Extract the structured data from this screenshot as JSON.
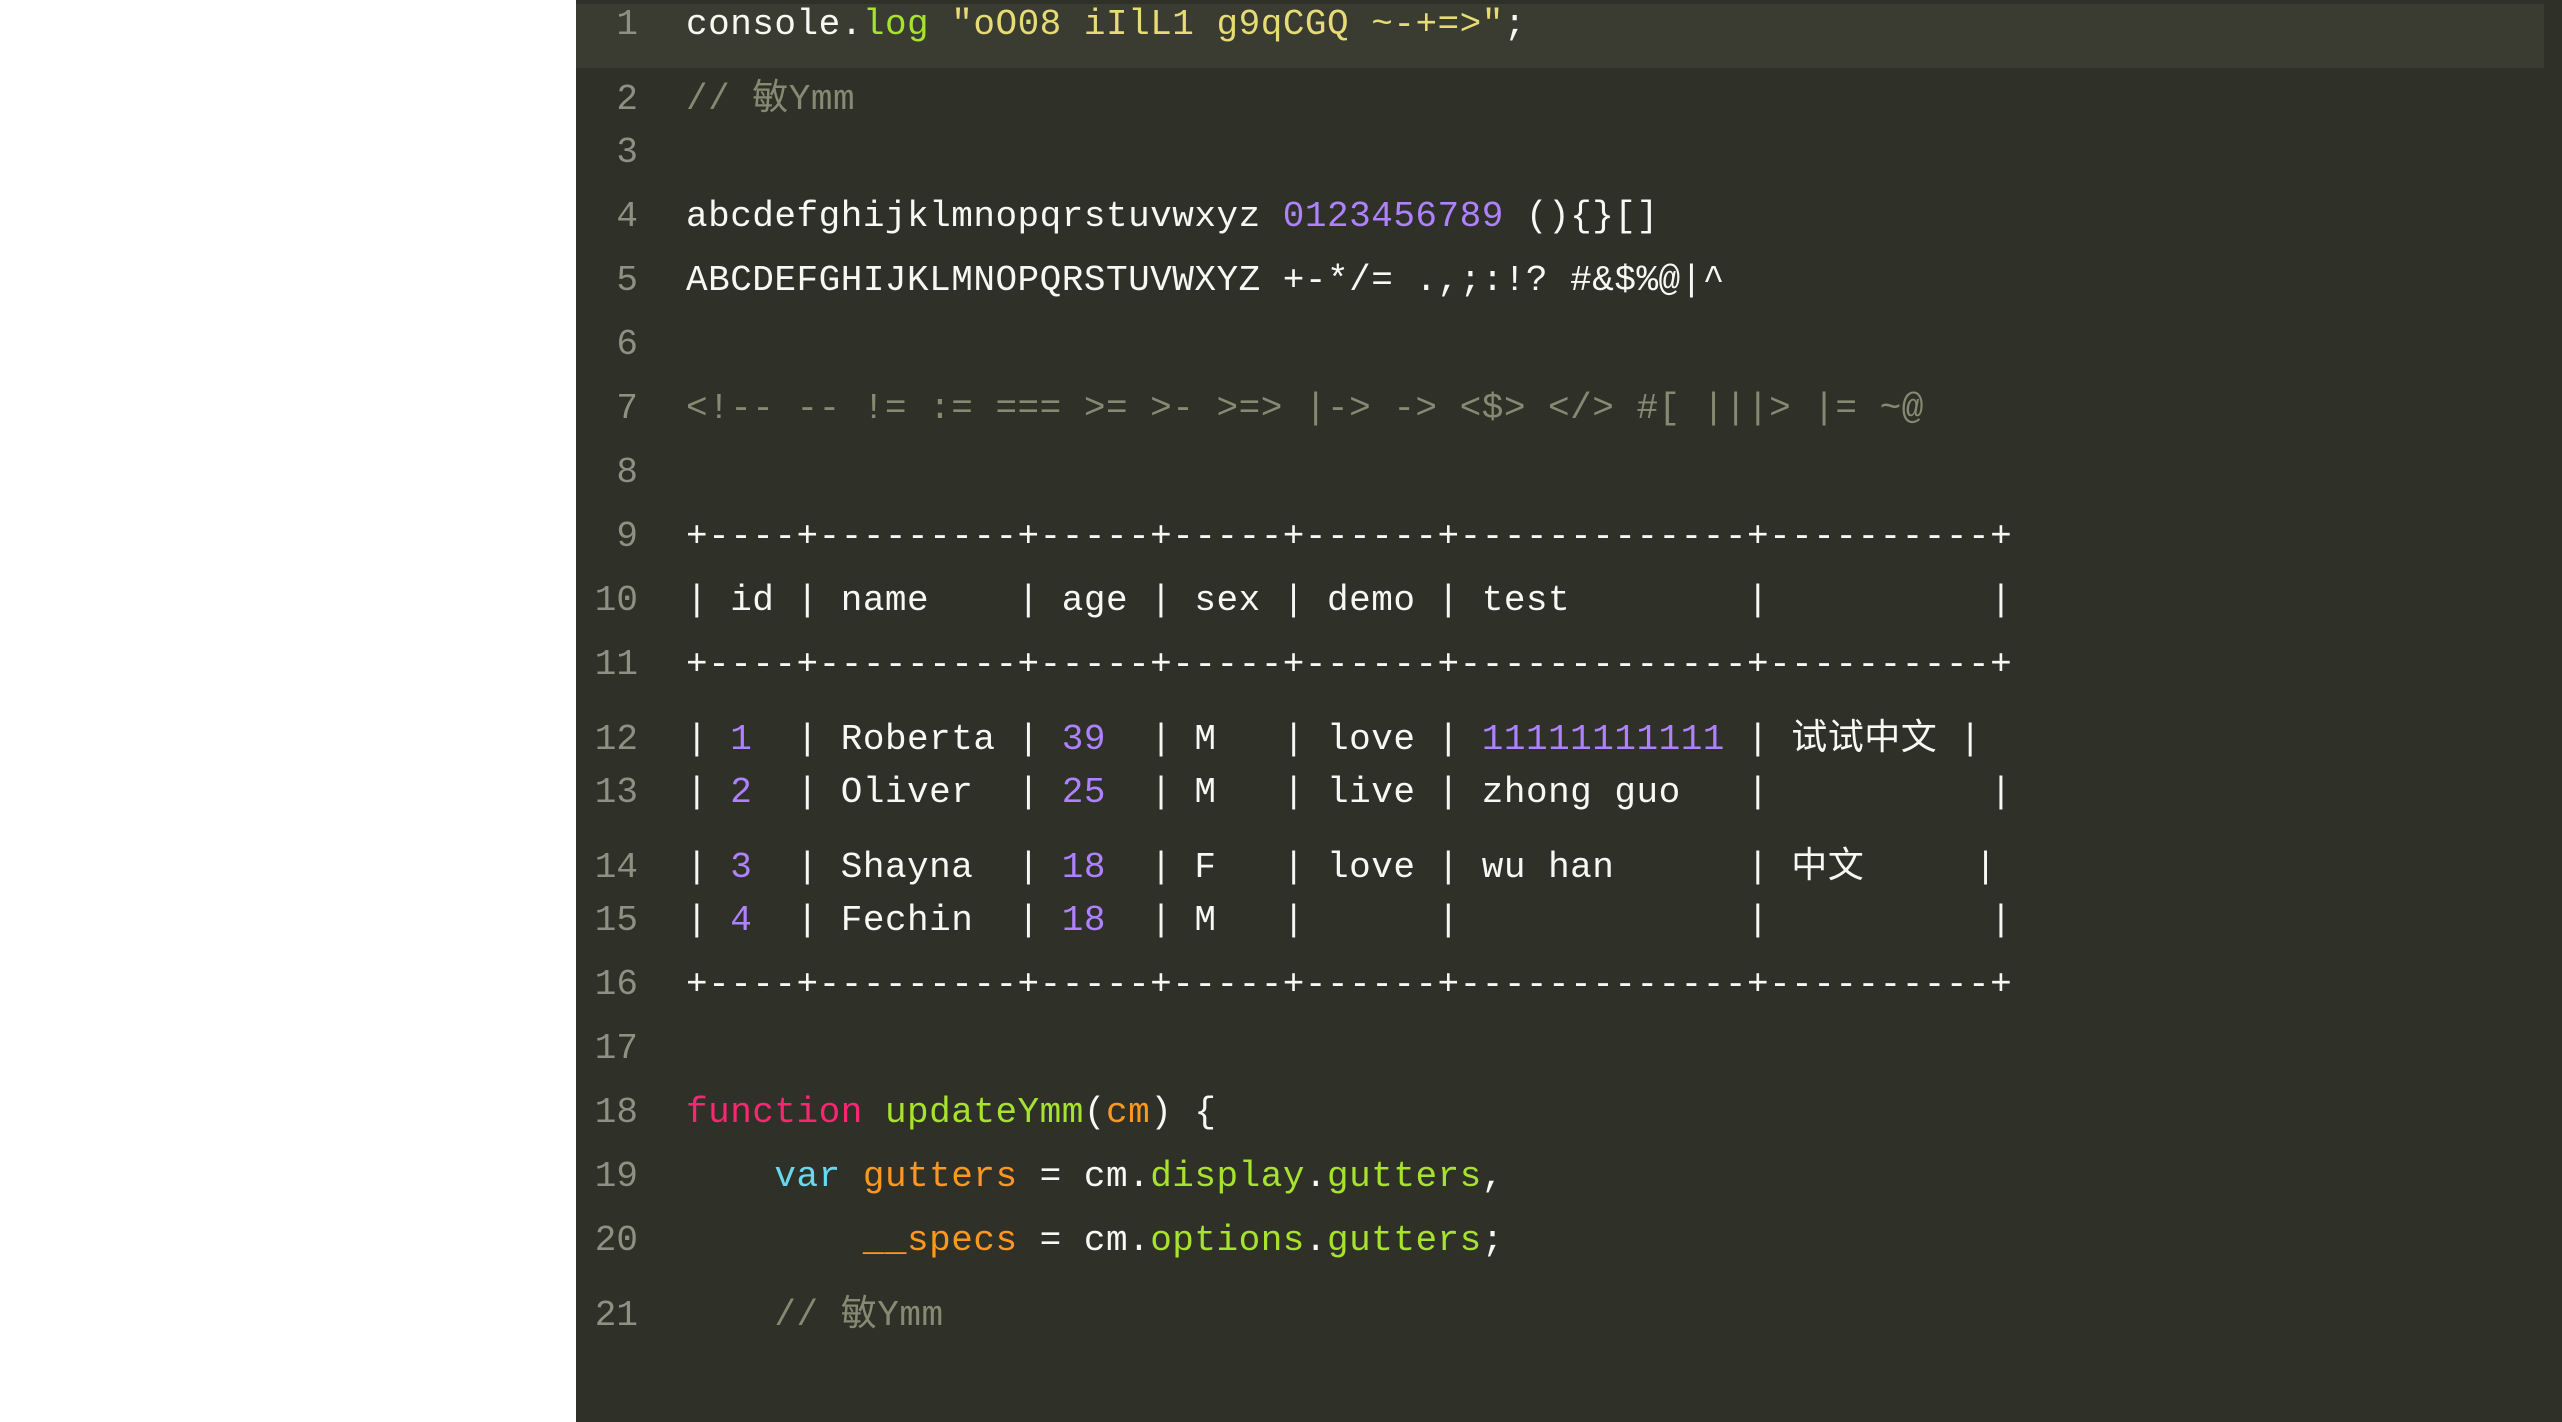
{
  "gutter": [
    "1",
    "2",
    "3",
    "4",
    "5",
    "6",
    "7",
    "8",
    "9",
    "10",
    "11",
    "12",
    "13",
    "14",
    "15",
    "16",
    "17",
    "18",
    "19",
    "20",
    "21"
  ],
  "l1": {
    "console": "console",
    "dot1": ".",
    "log": "log",
    "sp": " ",
    "q1": "\"",
    "str": "oO08 iIlL1 g9qCGQ ~-+=>",
    "q2": "\"",
    "semi": ";"
  },
  "l2": {
    "indent": "",
    "comment": "// 敏Ymm"
  },
  "l3": {
    "text": ""
  },
  "l4": {
    "alpha": "abcdefghijklmnopqrstuvwxyz ",
    "nums": "0123456789",
    "rest": " (){}[]"
  },
  "l5": {
    "text": "ABCDEFGHIJKLMNOPQRSTUVWXYZ +-*/= .,;:!? #&$%@|^"
  },
  "l6": {
    "text": ""
  },
  "l7": {
    "text": "<!-- -- != := === >= >- >=> |-> -> <$> </> #[ |||> |= ~@"
  },
  "l8": {
    "text": ""
  },
  "l9": {
    "text": "+----+---------+-----+-----+------+-------------+----------+"
  },
  "l10": {
    "text": "| id | name    | age | sex | demo | test        |          |"
  },
  "l11": {
    "text": "+----+---------+-----+-----+------+-------------+----------+"
  },
  "l12": {
    "a": "| ",
    "n": "1",
    "b": "  | Roberta | ",
    "age": "39",
    "c": "  | M   | love | ",
    "test": "11111111111",
    "d": " | 试试中文 |"
  },
  "l13": {
    "a": "| ",
    "n": "2",
    "b": "  | Oliver  | ",
    "age": "25",
    "c": "  | M   | live | zhong guo   |          |"
  },
  "l14": {
    "a": "| ",
    "n": "3",
    "b": "  | Shayna  | ",
    "age": "18",
    "c": "  | F   | love | wu han      | 中文     |"
  },
  "l15": {
    "a": "| ",
    "n": "4",
    "b": "  | Fechin  | ",
    "age": "18",
    "c": "  | M   |      |             |          |"
  },
  "l16": {
    "text": "+----+---------+-----+-----+------+-------------+----------+"
  },
  "l17": {
    "text": ""
  },
  "l18": {
    "kw": "function",
    "sp1": " ",
    "fn": "updateYmm",
    "open": "(",
    "param": "cm",
    "close": ") {"
  },
  "l19": {
    "indent": "    ",
    "kw": "var",
    "sp1": " ",
    "v1": "gutters",
    "mid": " = cm.",
    "p1": "display",
    "dot1": ".",
    "p2": "gutters",
    "tail": ","
  },
  "l20": {
    "indent": "        ",
    "v2": "__specs",
    "mid": " = cm.",
    "p1": "options",
    "dot1": ".",
    "p2": "gutters",
    "tail": ";"
  },
  "l21": {
    "indent": "    ",
    "comment": "// 敏Ymm"
  }
}
